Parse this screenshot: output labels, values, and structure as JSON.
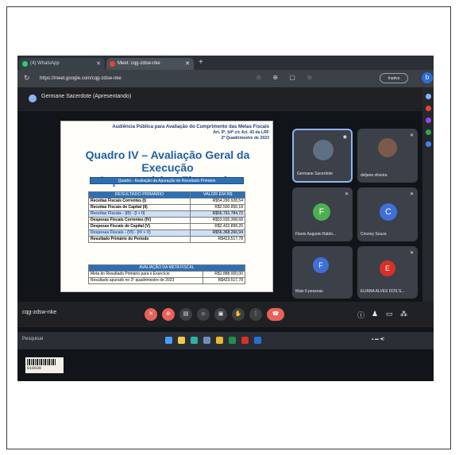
{
  "browser": {
    "tabs": [
      {
        "label": "(4) WhatsApp",
        "color": "#25d366"
      },
      {
        "label": "Meet: cqg-zdsw-nke",
        "color": "#ea4335"
      }
    ],
    "new_tab": "+",
    "url": "https://meet.google.com/cqg-zdsw-nke",
    "profile_label": "Inativo"
  },
  "meet": {
    "presenter_label": "Germane Sacerdote (Apresentando)",
    "meeting_code": "cqg-zdsw-nke"
  },
  "slide": {
    "header_line1": "Audiência Pública para Avaliação do Cumprimento das Metas Fiscais",
    "header_line2": "Art. 9º, §4º c/c Art. 43 da LRF",
    "header_line3": "2º Quadrimestre de 2023",
    "title_line1": "Quadro IV – Avaliação Geral da Execução",
    "title_line2": "Orçamentária e Financeira",
    "section_bar": "Quadro - Avaliação da Apuração do Resultado Primário",
    "table1": {
      "headers": [
        "RESULTADO PRIMÁRIO",
        "VALOR EM R$"
      ],
      "rows": [
        [
          "Receitas Fiscais Correntes (I)",
          "R$54.290.928,54"
        ],
        [
          "Receitas Fiscais de Capital (II)",
          "R$2.500.856,18"
        ],
        [
          "Receitas Fiscais - (III) - (I + II)",
          "R$56.791.784,72"
        ],
        [
          "Despesas Fiscais Correntes (IV)",
          "R$53.935.368,68"
        ],
        [
          "Despesas Fiscais de Capital (V)",
          "R$2.432.898,26"
        ],
        [
          "Despesas Fiscais - (VI) - (IV + V)",
          "R$56.368.266,94"
        ],
        [
          "Resultado Primário do Período",
          "R$423.517,78"
        ]
      ]
    },
    "table2": {
      "header": "AVALIAÇÃO DA META FISCAL",
      "rows": [
        [
          "Meta do Resultado Primário para o Exercício",
          "R$1.888.000,00"
        ],
        [
          "Resultado apurado no 2º quadrimestre de 2023",
          "R$423.517,78"
        ]
      ]
    }
  },
  "participants": [
    {
      "name": "Germane Sacerdote",
      "initial": "",
      "color": "#5f6f84"
    },
    {
      "name": "deljane oliveira",
      "initial": "",
      "color": "#7a5a4a"
    },
    {
      "name": "Flavio Augusto Baldo...",
      "initial": "F",
      "color": "#4caf50"
    },
    {
      "name": "Crisney Souza",
      "initial": "C",
      "color": "#3f6fd8"
    },
    {
      "name": "Mais 6 pessoas",
      "initial": "F",
      "color": "#3f6fd8"
    },
    {
      "name": "ELIANA ALVES DOS S...",
      "initial": "E",
      "color": "#d93025"
    }
  ],
  "taskbar": {
    "search_placeholder": "Pesquisar"
  },
  "sticker": {
    "code": "010030"
  }
}
